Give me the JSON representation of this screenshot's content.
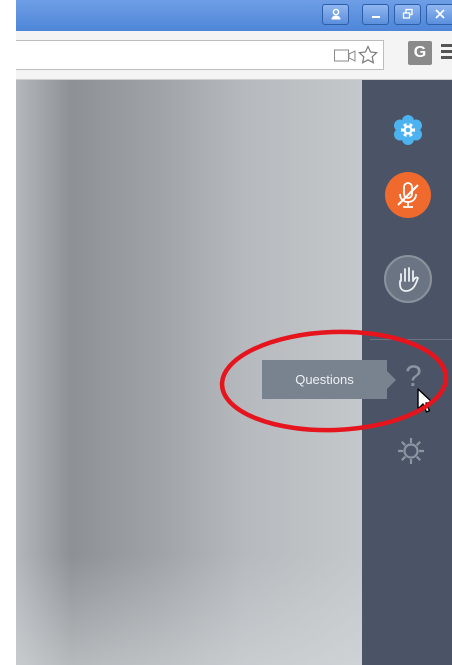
{
  "titlebar": {
    "buttons": [
      {
        "name": "profile-button",
        "icon": "person-icon"
      },
      {
        "name": "minimize-button",
        "icon": "minimize-icon"
      },
      {
        "name": "restore-button",
        "icon": "restore-icon"
      },
      {
        "name": "close-button",
        "icon": "close-icon"
      }
    ]
  },
  "toolbar": {
    "extension_letter": "G"
  },
  "sidebar": {
    "tooltip": "Questions"
  },
  "colors": {
    "sidebar": "#4a5466",
    "mic_active": "#f06a2e",
    "tooltip": "#79828f",
    "annotation": "#e5141d"
  }
}
